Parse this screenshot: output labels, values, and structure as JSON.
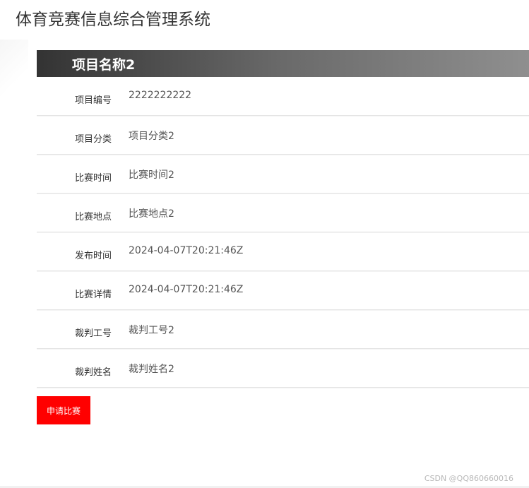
{
  "app": {
    "title": "体育竞赛信息综合管理系统"
  },
  "detail": {
    "title": "项目名称2",
    "fields": [
      {
        "label": "项目编号",
        "value": "2222222222"
      },
      {
        "label": "项目分类",
        "value": "项目分类2"
      },
      {
        "label": "比赛时间",
        "value": "比赛时间2"
      },
      {
        "label": "比赛地点",
        "value": "比赛地点2"
      },
      {
        "label": "发布时间",
        "value": "2024-04-07T20:21:46Z"
      },
      {
        "label": "比赛详情",
        "value": "2024-04-07T20:21:46Z"
      },
      {
        "label": "裁判工号",
        "value": "裁判工号2"
      },
      {
        "label": "裁判姓名",
        "value": "裁判姓名2"
      }
    ]
  },
  "actions": {
    "apply_label": "申请比赛"
  },
  "watermark": "CSDN @QQ860660016",
  "colors": {
    "button_bg": "#ff0000",
    "header_gradient_start": "#333333",
    "header_gradient_end": "#8f8f8f"
  }
}
